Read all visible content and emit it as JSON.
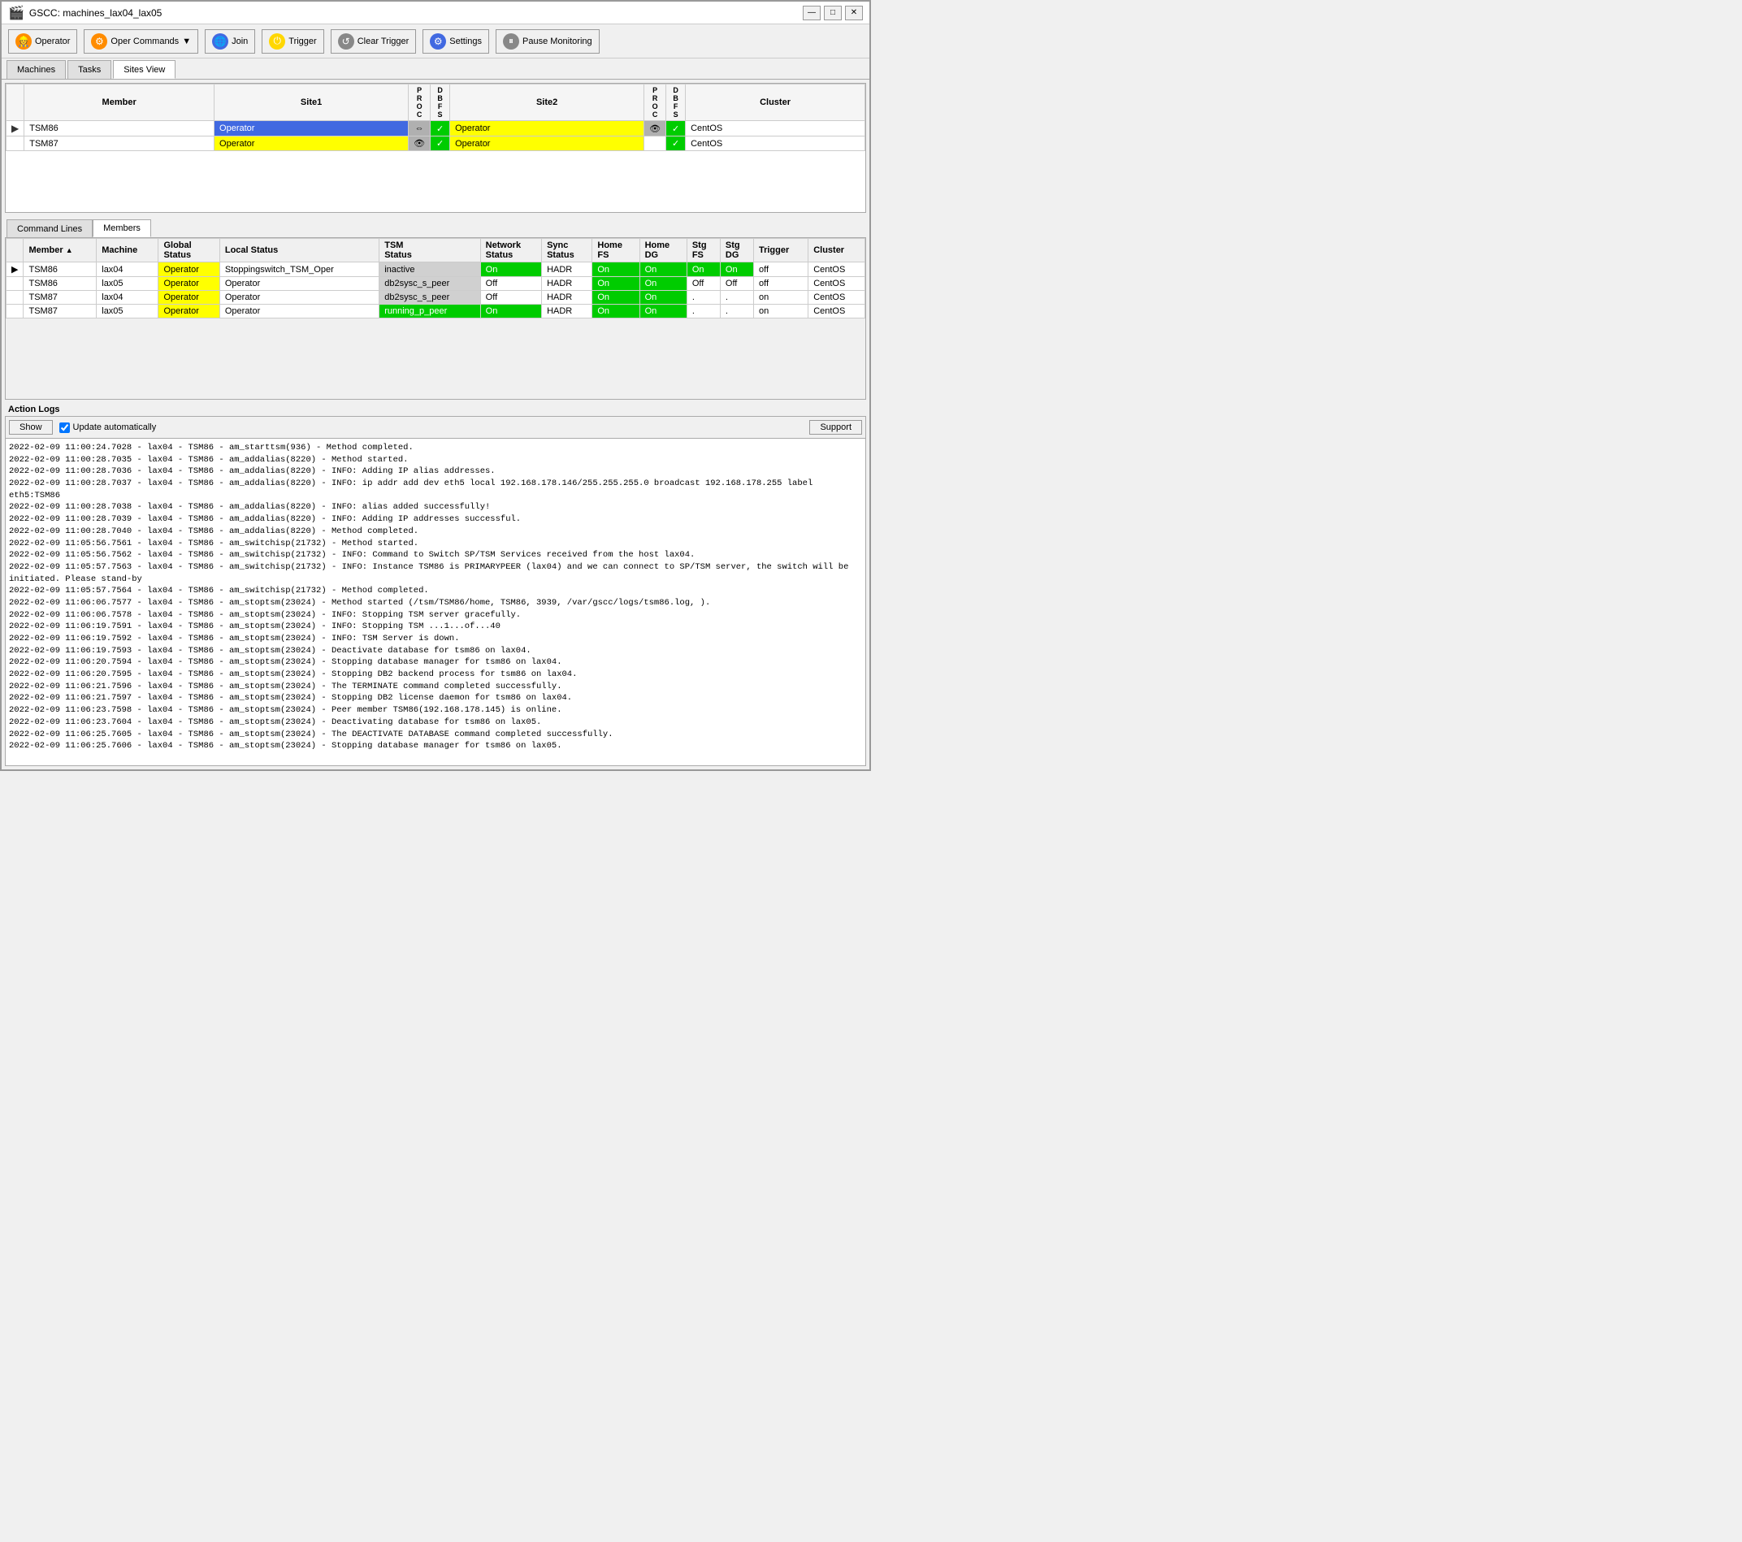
{
  "window": {
    "title": "GSCC: machines_lax04_lax05",
    "min_label": "—",
    "max_label": "□",
    "close_label": "✕"
  },
  "toolbar": {
    "operator_label": "Operator",
    "oper_commands_label": "Oper Commands",
    "join_label": "Join",
    "trigger_label": "Trigger",
    "clear_trigger_label": "Clear Trigger",
    "settings_label": "Settings",
    "pause_monitoring_label": "Pause Monitoring"
  },
  "main_tabs": [
    {
      "label": "Machines",
      "active": false
    },
    {
      "label": "Tasks",
      "active": false
    },
    {
      "label": "Sites View",
      "active": true
    }
  ],
  "sites_view": {
    "headers": {
      "member": "Member",
      "site1": "Site1",
      "proc": "P\nR\nO\nC",
      "dbfs1": "D\nB\nF\nS",
      "site2": "Site2",
      "proc2": "P\nR\nO\nC",
      "dbfs2": "D\nB\nF\nS",
      "cluster": "Cluster"
    },
    "rows": [
      {
        "arrow": "▶",
        "member": "TSM86",
        "site1": "Operator",
        "site1_color": "blue",
        "proc1_icon": "⇔",
        "proc1_check": "✓",
        "proc1_check_color": "green",
        "site2": "Operator",
        "site2_color": "yellow",
        "proc2_icon": "👁",
        "proc2_check": "✓",
        "proc2_check_color": "green",
        "dbfs2_check": "✓",
        "dbfs2_check_color": "green",
        "cluster": "CentOS"
      },
      {
        "arrow": "",
        "member": "TSM87",
        "site1": "Operator",
        "site1_color": "yellow",
        "proc1_icon": "👁",
        "proc1_check": "✓",
        "proc1_check_color": "green",
        "site2": "Operator",
        "site2_color": "yellow",
        "proc2_icon": "",
        "proc2_check": "✓",
        "proc2_check_color": "green",
        "dbfs2_check": "✓",
        "dbfs2_check_color": "green",
        "cluster": "CentOS"
      }
    ]
  },
  "section_tabs": [
    {
      "label": "Command Lines",
      "active": false
    },
    {
      "label": "Members",
      "active": true
    }
  ],
  "members_table": {
    "headers": [
      "",
      "Member",
      "Machine",
      "Global Status",
      "Local Status",
      "TSM Status",
      "Network Status",
      "Sync Status",
      "Home FS",
      "Home DG",
      "Stg FS",
      "Stg DG",
      "Trigger",
      "Cluster"
    ],
    "rows": [
      {
        "arrow": "▶",
        "member": "TSM86",
        "machine": "lax04",
        "global_status": "Operator",
        "global_color": "yellow",
        "local_status": "Stoppingswitch_TSM_Oper",
        "local_color": "white",
        "tsm_status": "inactive",
        "tsm_color": "grey",
        "network_status": "On",
        "network_color": "green",
        "sync_status": "HADR",
        "home_fs": "On",
        "home_fs_color": "green",
        "home_dg": "On",
        "home_dg_color": "green",
        "stg_fs": "On",
        "stg_fs_color": "green",
        "stg_dg": "On",
        "stg_dg_color": "green",
        "trigger": "off",
        "cluster": "CentOS"
      },
      {
        "arrow": "",
        "member": "TSM86",
        "machine": "lax05",
        "global_status": "Operator",
        "global_color": "yellow",
        "local_status": "Operator",
        "local_color": "white",
        "tsm_status": "db2sysc_s_peer",
        "tsm_color": "grey",
        "network_status": "Off",
        "network_color": "white",
        "sync_status": "HADR",
        "home_fs": "On",
        "home_fs_color": "green",
        "home_dg": "On",
        "home_dg_color": "green",
        "stg_fs": "Off",
        "stg_fs_color": "white",
        "stg_dg": "Off",
        "stg_dg_color": "white",
        "trigger": "off",
        "cluster": "CentOS"
      },
      {
        "arrow": "",
        "member": "TSM87",
        "machine": "lax04",
        "global_status": "Operator",
        "global_color": "yellow",
        "local_status": "Operator",
        "local_color": "white",
        "tsm_status": "db2sysc_s_peer",
        "tsm_color": "grey",
        "network_status": "Off",
        "network_color": "white",
        "sync_status": "HADR",
        "home_fs": "On",
        "home_fs_color": "green",
        "home_dg": "On",
        "home_dg_color": "green",
        "stg_fs": ".",
        "stg_fs_color": "white",
        "stg_dg": ".",
        "stg_dg_color": "white",
        "trigger": "on",
        "cluster": "CentOS"
      },
      {
        "arrow": "",
        "member": "TSM87",
        "machine": "lax05",
        "global_status": "Operator",
        "global_color": "yellow",
        "local_status": "Operator",
        "local_color": "white",
        "tsm_status": "running_p_peer",
        "tsm_color": "green",
        "network_status": "On",
        "network_color": "green",
        "sync_status": "HADR",
        "home_fs": "On",
        "home_fs_color": "green",
        "home_dg": "On",
        "home_dg_color": "green",
        "stg_fs": ".",
        "stg_fs_color": "white",
        "stg_dg": ".",
        "stg_dg_color": "white",
        "trigger": "on",
        "cluster": "CentOS"
      }
    ]
  },
  "action_logs": {
    "label": "Action Logs",
    "show_label": "Show",
    "update_auto_label": "Update automatically",
    "support_label": "Support",
    "lines": [
      "2022-02-09 11:00:24.7028 - lax04 - TSM86 - am_starttsm(936) - Method completed.",
      "2022-02-09 11:00:28.7035 - lax04 - TSM86 - am_addalias(8220) - Method started.",
      "2022-02-09 11:00:28.7036 - lax04 - TSM86 - am_addalias(8220) - INFO: Adding IP alias addresses.",
      "2022-02-09 11:00:28.7037 - lax04 - TSM86 - am_addalias(8220) - INFO: ip addr add dev eth5 local 192.168.178.146/255.255.255.0 broadcast 192.168.178.255 label eth5:TSM86",
      "2022-02-09 11:00:28.7038 - lax04 - TSM86 - am_addalias(8220) - INFO: alias added successfully!",
      "2022-02-09 11:00:28.7039 - lax04 - TSM86 - am_addalias(8220) - INFO: Adding IP addresses successful.",
      "2022-02-09 11:00:28.7040 - lax04 - TSM86 - am_addalias(8220) - Method completed.",
      "2022-02-09 11:05:56.7561 - lax04 - TSM86 - am_switchisp(21732) - Method started.",
      "2022-02-09 11:05:56.7562 - lax04 - TSM86 - am_switchisp(21732) - INFO: Command to Switch SP/TSM Services received from the host lax04.",
      "2022-02-09 11:05:57.7563 - lax04 - TSM86 - am_switchisp(21732) - INFO: Instance TSM86 is PRIMARYPEER (lax04) and we can connect to SP/TSM server, the switch will be initiated. Please stand-by",
      "2022-02-09 11:05:57.7564 - lax04 - TSM86 - am_switchisp(21732) - Method completed.",
      "2022-02-09 11:06:06.7577 - lax04 - TSM86 - am_stoptsm(23024) - Method started (/tsm/TSM86/home, TSM86, 3939, /var/gscc/logs/tsm86.log, ).",
      "2022-02-09 11:06:06.7578 - lax04 - TSM86 - am_stoptsm(23024) - INFO: Stopping TSM server gracefully.",
      "2022-02-09 11:06:19.7591 - lax04 - TSM86 - am_stoptsm(23024) - INFO: Stopping TSM ...1...of...40",
      "2022-02-09 11:06:19.7592 - lax04 - TSM86 - am_stoptsm(23024) - INFO: TSM Server is down.",
      "2022-02-09 11:06:19.7593 - lax04 - TSM86 - am_stoptsm(23024) - Deactivate database for tsm86 on lax04.",
      "2022-02-09 11:06:20.7594 - lax04 - TSM86 - am_stoptsm(23024) - Stopping database manager for tsm86 on lax04.",
      "2022-02-09 11:06:20.7595 - lax04 - TSM86 - am_stoptsm(23024) - Stopping DB2 backend process for tsm86 on lax04.",
      "2022-02-09 11:06:21.7596 - lax04 - TSM86 - am_stoptsm(23024) - The TERMINATE command completed successfully.",
      "2022-02-09 11:06:21.7597 - lax04 - TSM86 - am_stoptsm(23024) - Stopping DB2 license daemon for tsm86 on lax04.",
      "2022-02-09 11:06:23.7598 - lax04 - TSM86 - am_stoptsm(23024) - Peer member TSM86(192.168.178.145) is online.",
      "2022-02-09 11:06:23.7604 - lax04 - TSM86 - am_stoptsm(23024) - Deactivating database for tsm86 on lax05.",
      "2022-02-09 11:06:25.7605 - lax04 - TSM86 - am_stoptsm(23024) - The DEACTIVATE DATABASE command completed successfully.",
      "2022-02-09 11:06:25.7606 - lax04 - TSM86 - am_stoptsm(23024) - Stopping database manager for tsm86 on lax05."
    ]
  }
}
